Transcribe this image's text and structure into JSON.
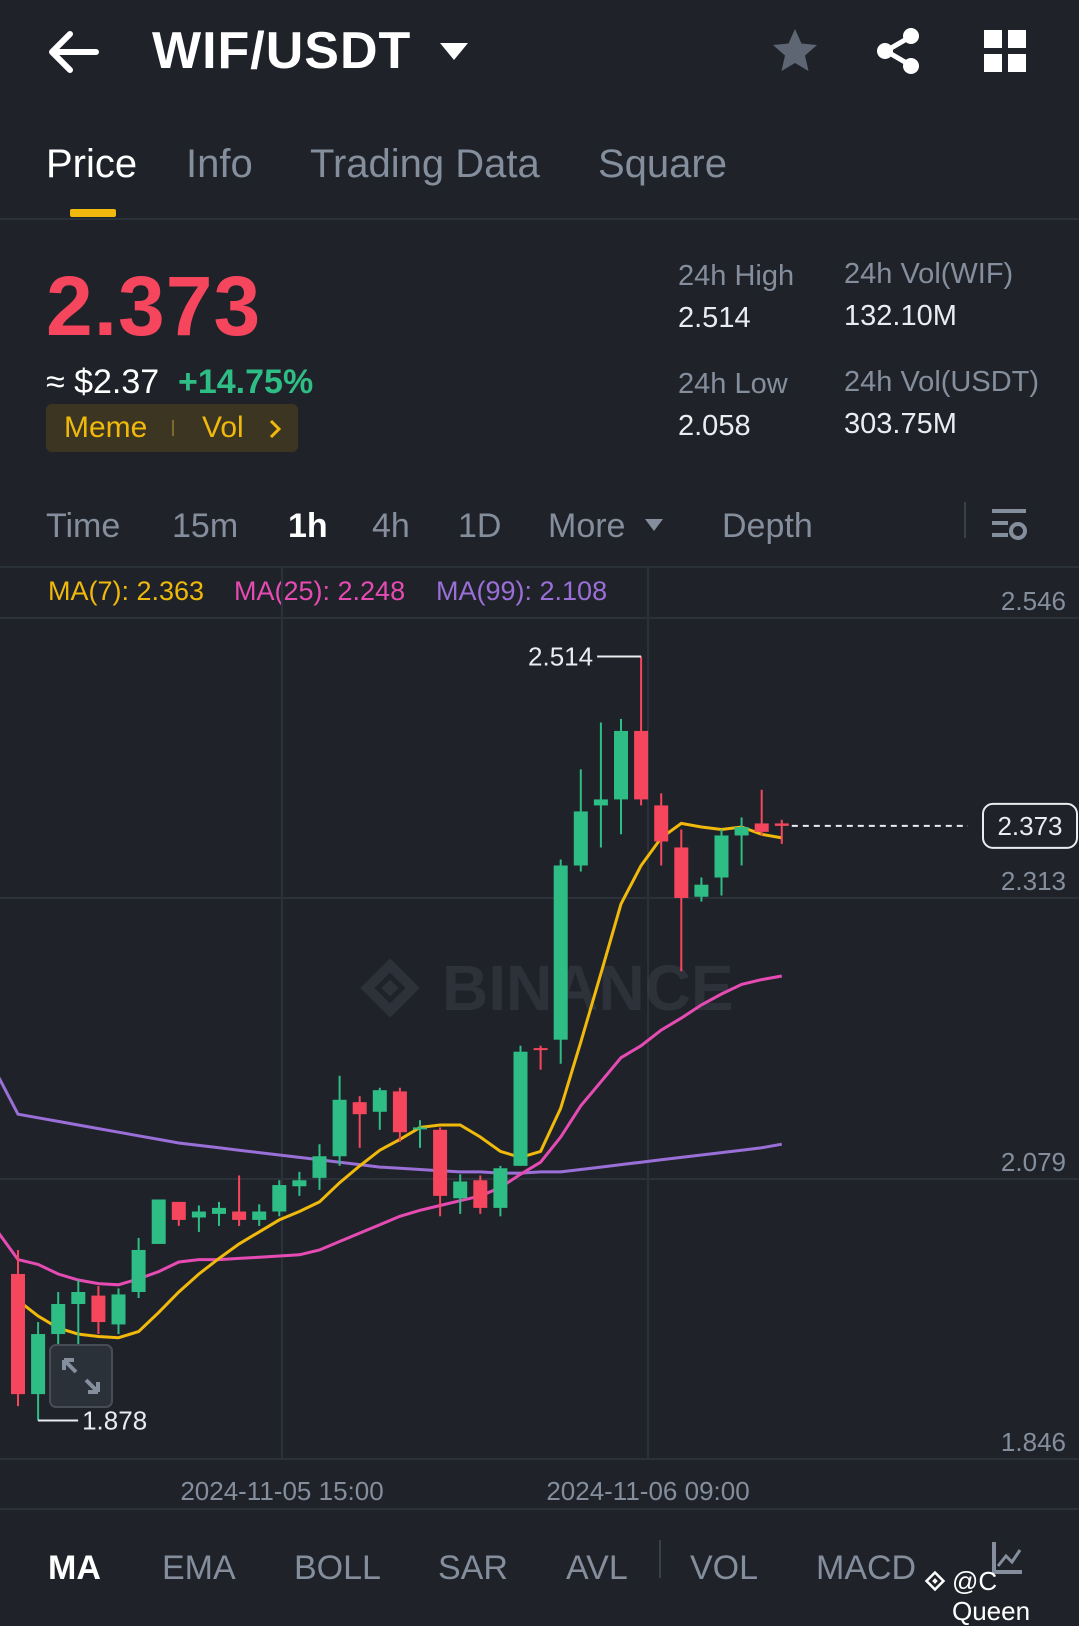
{
  "header": {
    "pair": "WIF/USDT",
    "icons": [
      "back-arrow-icon",
      "dropdown-caret-icon",
      "star-icon",
      "share-icon",
      "grid-menu-icon"
    ]
  },
  "tabs": [
    {
      "label": "Price",
      "active": true
    },
    {
      "label": "Info",
      "active": false
    },
    {
      "label": "Trading Data",
      "active": false
    },
    {
      "label": "Square",
      "active": false
    }
  ],
  "price": {
    "last": "2.373",
    "usd": "≈ $2.37",
    "change": "+14.75%",
    "tags": [
      "Meme",
      "Vol"
    ]
  },
  "stats": {
    "high_label": "24h High",
    "high_value": "2.514",
    "low_label": "24h Low",
    "low_value": "2.058",
    "vol_base_label": "24h Vol(WIF)",
    "vol_base_value": "132.10M",
    "vol_quote_label": "24h Vol(USDT)",
    "vol_quote_value": "303.75M"
  },
  "intervals": {
    "time": "Time",
    "m15": "15m",
    "h1": "1h",
    "h4": "4h",
    "d1": "1D",
    "more": "More",
    "depth": "Depth",
    "selected": "1h"
  },
  "ma_legend": {
    "ma7": "MA(7): 2.363",
    "ma25": "MA(25): 2.248",
    "ma99": "MA(99): 2.108"
  },
  "colors": {
    "up": "#2ebd85",
    "down": "#f6465d",
    "ma7": "#f0b90b",
    "ma25": "#e64bb4",
    "ma99": "#9a6fd8",
    "accent": "#f0b90b",
    "background": "#1f2329"
  },
  "chart_data": {
    "type": "candlestick",
    "price_axis_ticks": [
      "2.546",
      "2.313",
      "2.079",
      "1.846"
    ],
    "time_axis_ticks": [
      "2024-11-05 15:00",
      "2024-11-06 09:00"
    ],
    "high_marker": "2.514",
    "low_marker": "1.878",
    "current_price_marker": "2.373",
    "watermark": "BINANCE",
    "candles": [
      {
        "o": 2.0,
        "h": 2.02,
        "l": 1.89,
        "c": 1.9
      },
      {
        "o": 1.9,
        "h": 1.96,
        "l": 1.878,
        "c": 1.95
      },
      {
        "o": 1.95,
        "h": 1.985,
        "l": 1.9,
        "c": 1.975
      },
      {
        "o": 1.975,
        "h": 1.995,
        "l": 1.94,
        "c": 1.985
      },
      {
        "o": 1.982,
        "h": 1.99,
        "l": 1.95,
        "c": 1.96
      },
      {
        "o": 1.958,
        "h": 1.988,
        "l": 1.95,
        "c": 1.983
      },
      {
        "o": 1.985,
        "h": 2.03,
        "l": 1.98,
        "c": 2.02
      },
      {
        "o": 2.025,
        "h": 2.062,
        "l": 2.025,
        "c": 2.062
      },
      {
        "o": 2.06,
        "h": 2.06,
        "l": 2.04,
        "c": 2.045
      },
      {
        "o": 2.047,
        "h": 2.057,
        "l": 2.035,
        "c": 2.052
      },
      {
        "o": 2.05,
        "h": 2.06,
        "l": 2.04,
        "c": 2.055
      },
      {
        "o": 2.052,
        "h": 2.082,
        "l": 2.04,
        "c": 2.045
      },
      {
        "o": 2.045,
        "h": 2.058,
        "l": 2.04,
        "c": 2.052
      },
      {
        "o": 2.052,
        "h": 2.078,
        "l": 2.048,
        "c": 2.074
      },
      {
        "o": 2.073,
        "h": 2.085,
        "l": 2.065,
        "c": 2.078
      },
      {
        "o": 2.08,
        "h": 2.108,
        "l": 2.07,
        "c": 2.098
      },
      {
        "o": 2.098,
        "h": 2.165,
        "l": 2.09,
        "c": 2.145
      },
      {
        "o": 2.143,
        "h": 2.148,
        "l": 2.105,
        "c": 2.133
      },
      {
        "o": 2.135,
        "h": 2.155,
        "l": 2.12,
        "c": 2.153
      },
      {
        "o": 2.152,
        "h": 2.155,
        "l": 2.11,
        "c": 2.118
      },
      {
        "o": 2.122,
        "h": 2.128,
        "l": 2.105,
        "c": 2.122
      },
      {
        "o": 2.12,
        "h": 2.122,
        "l": 2.048,
        "c": 2.065
      },
      {
        "o": 2.063,
        "h": 2.083,
        "l": 2.05,
        "c": 2.077
      },
      {
        "o": 2.078,
        "h": 2.082,
        "l": 2.05,
        "c": 2.055
      },
      {
        "o": 2.055,
        "h": 2.09,
        "l": 2.048,
        "c": 2.088
      },
      {
        "o": 2.09,
        "h": 2.19,
        "l": 2.09,
        "c": 2.185
      },
      {
        "o": 2.188,
        "h": 2.19,
        "l": 2.17,
        "c": 2.187
      },
      {
        "o": 2.195,
        "h": 2.345,
        "l": 2.175,
        "c": 2.34
      },
      {
        "o": 2.34,
        "h": 2.42,
        "l": 2.335,
        "c": 2.385
      },
      {
        "o": 2.39,
        "h": 2.459,
        "l": 2.355,
        "c": 2.395
      },
      {
        "o": 2.395,
        "h": 2.462,
        "l": 2.366,
        "c": 2.452
      },
      {
        "o": 2.452,
        "h": 2.514,
        "l": 2.39,
        "c": 2.395
      },
      {
        "o": 2.39,
        "h": 2.4,
        "l": 2.34,
        "c": 2.36
      },
      {
        "o": 2.355,
        "h": 2.37,
        "l": 2.252,
        "c": 2.313
      },
      {
        "o": 2.314,
        "h": 2.33,
        "l": 2.31,
        "c": 2.324
      },
      {
        "o": 2.33,
        "h": 2.37,
        "l": 2.315,
        "c": 2.365
      },
      {
        "o": 2.365,
        "h": 2.38,
        "l": 2.34,
        "c": 2.372
      },
      {
        "o": 2.375,
        "h": 2.403,
        "l": 2.365,
        "c": 2.368
      },
      {
        "o": 2.375,
        "h": 2.378,
        "l": 2.358,
        "c": 2.373
      }
    ],
    "ma7": [
      1.978,
      1.965,
      1.955,
      1.95,
      1.948,
      1.947,
      1.952,
      1.968,
      1.985,
      2.0,
      2.013,
      2.025,
      2.035,
      2.045,
      2.052,
      2.06,
      2.076,
      2.09,
      2.103,
      2.112,
      2.122,
      2.124,
      2.124,
      2.114,
      2.102,
      2.097,
      2.102,
      2.138,
      2.193,
      2.25,
      2.308,
      2.34,
      2.363,
      2.375,
      2.372,
      2.37,
      2.372,
      2.366,
      2.363
    ],
    "ma25": [
      2.012,
      2.008,
      2.0,
      1.995,
      1.992,
      1.991,
      1.996,
      2.002,
      2.01,
      2.012,
      2.012,
      2.013,
      2.014,
      2.015,
      2.016,
      2.02,
      2.027,
      2.034,
      2.041,
      2.048,
      2.053,
      2.057,
      2.061,
      2.065,
      2.072,
      2.083,
      2.093,
      2.114,
      2.14,
      2.16,
      2.18,
      2.19,
      2.203,
      2.213,
      2.224,
      2.233,
      2.241,
      2.245,
      2.248
    ],
    "ma99": [
      2.133,
      2.13,
      2.127,
      2.124,
      2.121,
      2.118,
      2.115,
      2.112,
      2.109,
      2.107,
      2.105,
      2.103,
      2.101,
      2.099,
      2.097,
      2.095,
      2.093,
      2.091,
      2.089,
      2.088,
      2.087,
      2.086,
      2.085,
      2.085,
      2.084,
      2.084,
      2.085,
      2.085,
      2.087,
      2.089,
      2.091,
      2.093,
      2.095,
      2.097,
      2.099,
      2.101,
      2.103,
      2.105,
      2.108
    ],
    "y_range": [
      1.846,
      2.546
    ]
  },
  "indicators": {
    "items": [
      "MA",
      "EMA",
      "BOLL",
      "SAR",
      "AVL",
      "VOL",
      "MACD"
    ],
    "selected": "MA"
  },
  "watermark_user": "@C Queen"
}
